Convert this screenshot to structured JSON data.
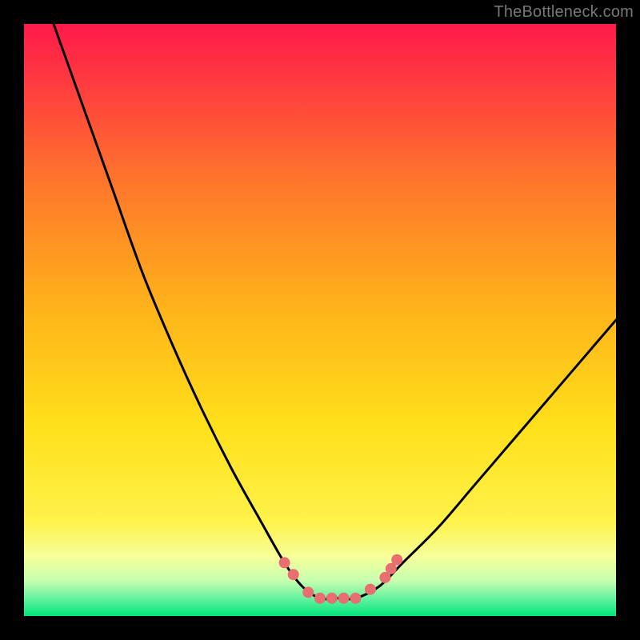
{
  "watermark": {
    "text": "TheBottleneck.com"
  },
  "colors": {
    "frame": "#000000",
    "gradient_top": "#ff1a4a",
    "gradient_mid": "#ffd21a",
    "gradient_bottom_band": "#f6ff9a",
    "gradient_green": "#00e67a",
    "curve": "#000000",
    "marker": "#e76f6f"
  },
  "chart_data": {
    "type": "line",
    "title": "",
    "xlabel": "",
    "ylabel": "",
    "xlim": [
      0,
      100
    ],
    "ylim": [
      0,
      100
    ],
    "series": [
      {
        "name": "bottleneck-curve",
        "x": [
          5,
          10,
          15,
          20,
          25,
          30,
          35,
          40,
          44,
          47,
          50,
          53,
          56,
          60,
          64,
          70,
          76,
          82,
          88,
          94,
          100
        ],
        "y": [
          100,
          86,
          72,
          58,
          46,
          35,
          25,
          16,
          9,
          5,
          3,
          3,
          3,
          5,
          9,
          15,
          22,
          29,
          36,
          43,
          50
        ]
      }
    ],
    "markers": {
      "name": "highlight-points",
      "points": [
        {
          "x": 44,
          "y": 9
        },
        {
          "x": 45.5,
          "y": 7
        },
        {
          "x": 48,
          "y": 4
        },
        {
          "x": 50,
          "y": 3
        },
        {
          "x": 52,
          "y": 3
        },
        {
          "x": 54,
          "y": 3
        },
        {
          "x": 56,
          "y": 3
        },
        {
          "x": 58.5,
          "y": 4.5
        },
        {
          "x": 61,
          "y": 6.5
        },
        {
          "x": 62,
          "y": 8
        },
        {
          "x": 63,
          "y": 9.5
        }
      ]
    }
  }
}
